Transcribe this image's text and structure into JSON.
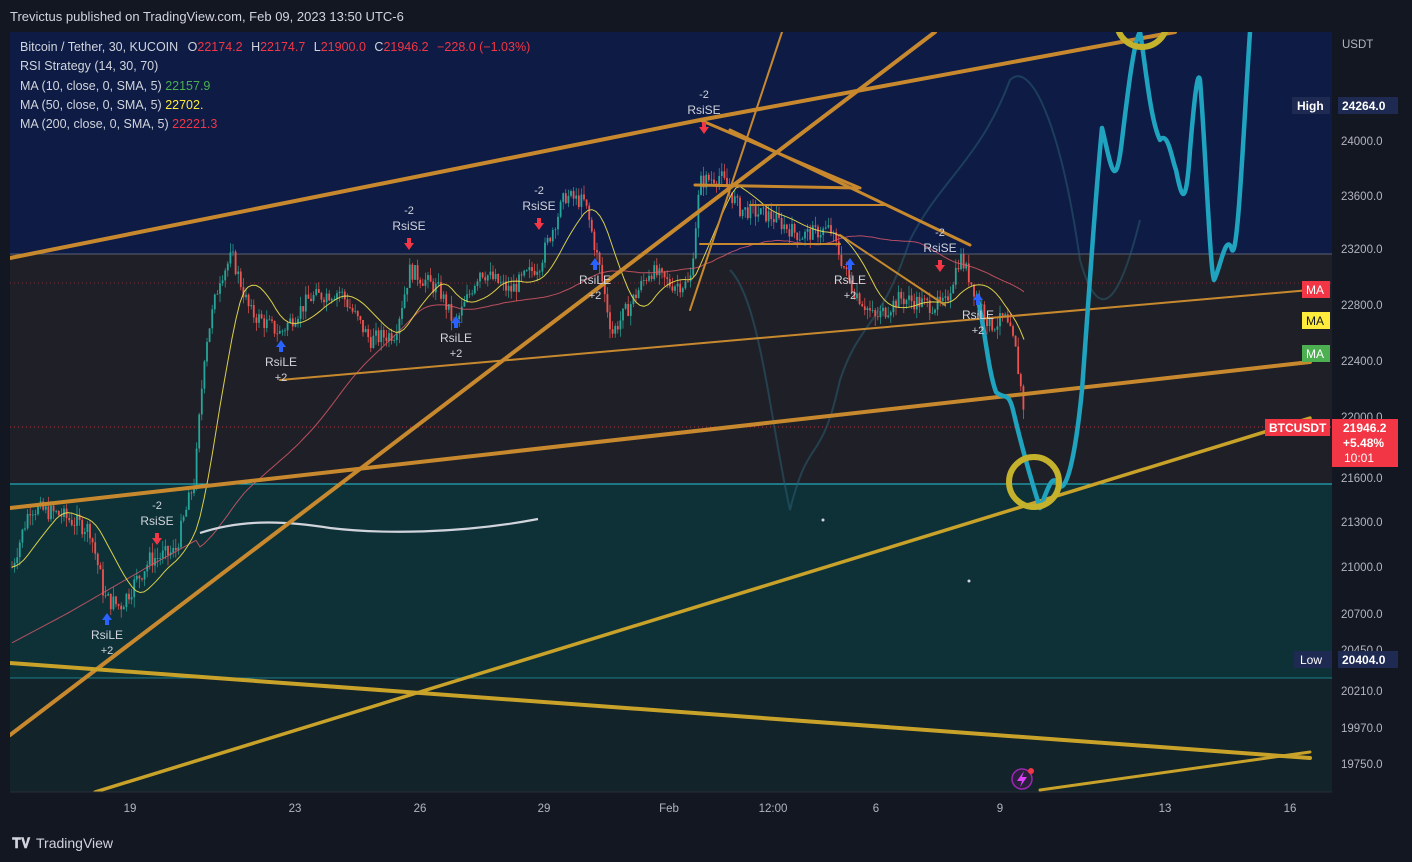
{
  "header": {
    "published": "Trevictus published on TradingView.com, Feb 09, 2023 13:50 UTC-6"
  },
  "legend": {
    "symbol": "Bitcoin / Tether, 30, KUCOIN",
    "o_label": "O",
    "o_value": "22174.2",
    "h_label": "H",
    "h_value": "22174.7",
    "l_label": "L",
    "l_value": "21900.0",
    "c_label": "C",
    "c_value": "21946.2",
    "change": "−228.0 (−1.03%)",
    "rsi": "RSI Strategy (14, 30, 70)",
    "ma10": "MA (10, close, 0, SMA, 5)",
    "ma10_value": "22157.9",
    "ma50": "MA (50, close, 0, SMA, 5)",
    "ma50_value": "22702.",
    "ma200": "MA (200, close, 0, SMA, 5)",
    "ma200_value": "22221.3",
    "ma10_color": "#4caf50",
    "ma50_color": "#ffeb3b",
    "ma200_color": "#f23645"
  },
  "footer": {
    "brand": "TradingView"
  },
  "chart_data": {
    "type": "candlestick",
    "currency": "USDT",
    "y_ticks": [
      24000.0,
      23600.0,
      23200.0,
      22800.0,
      22400.0,
      22000.0,
      21600.0,
      21300.0,
      21000.0,
      20700.0,
      20450.0,
      20210.0,
      19970.0,
      19750.0
    ],
    "y_tick_labels": [
      "24000.0",
      "23600.0",
      "23200.0",
      "22800.0",
      "22400.0",
      "22000.0",
      "21600.0",
      "21300.0",
      "21000.0",
      "20700.0",
      "20450.0",
      "20210.0",
      "19970.0",
      "19750.0"
    ],
    "x_ticks": [
      "19",
      "23",
      "26",
      "29",
      "Feb",
      "12:00",
      "6",
      "9",
      "13",
      "16"
    ],
    "high": {
      "label": "High",
      "value": "24264.0"
    },
    "low": {
      "label": "Low",
      "value": "20404.0"
    },
    "last_price": {
      "symbol": "BTCUSDT",
      "value": "21946.2",
      "change": "+5.48%",
      "countdown": "10:01"
    },
    "ma_tags": [
      {
        "label": "MA",
        "color": "#f23645"
      },
      {
        "label": "MA",
        "color": "#ffeb3b"
      },
      {
        "label": "MA",
        "color": "#4caf50"
      }
    ],
    "signals": [
      {
        "kind": "RsiLE",
        "count": "+2",
        "date": "Jan 18"
      },
      {
        "kind": "RsiSE",
        "count": "-2",
        "date": "Jan 19"
      },
      {
        "kind": "RsiLE",
        "count": "+2",
        "date": "Jan 23"
      },
      {
        "kind": "RsiSE",
        "count": "-2",
        "date": "Jan 25"
      },
      {
        "kind": "RsiLE",
        "count": "+2",
        "date": "Jan 27"
      },
      {
        "kind": "RsiSE",
        "count": "-2",
        "date": "Jan 29"
      },
      {
        "kind": "RsiLE",
        "count": "+2",
        "date": "Jan 31"
      },
      {
        "kind": "RsiSE",
        "count": "-2",
        "date": "Feb 1"
      },
      {
        "kind": "RsiLE",
        "count": "+2",
        "date": "Feb 5"
      },
      {
        "kind": "RsiSE",
        "count": "-2",
        "date": "Feb 7"
      },
      {
        "kind": "RsiLE",
        "count": "+2",
        "date": "Feb 8"
      }
    ],
    "zones": {
      "upper_line": 23200.0,
      "mid_line": 21600.0,
      "low_line": 20300.0
    }
  }
}
